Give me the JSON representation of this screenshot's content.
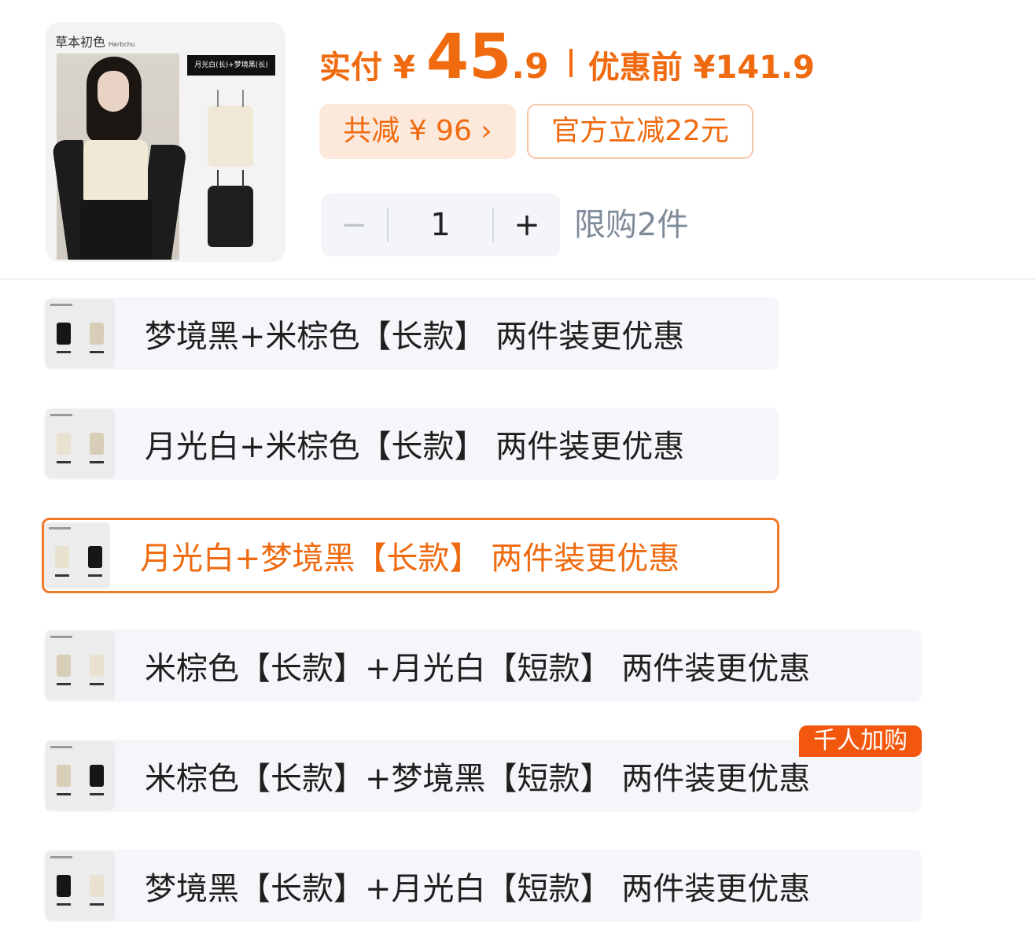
{
  "product": {
    "brand": "草本初色",
    "brand_sub": "Herbchu",
    "image_tag": "月光白(长)+梦境黑(长)"
  },
  "price": {
    "pay_label": "实付",
    "currency": "¥",
    "final_int": "45",
    "final_dec": ".9",
    "original_label": "优惠前 ¥141.9"
  },
  "discounts": {
    "total_save": "共减 ¥ 96 ›",
    "official": "官方立减22元"
  },
  "quantity": {
    "minus": "−",
    "value": "1",
    "plus": "+",
    "limit": "限购2件"
  },
  "options": [
    {
      "label": "梦境黑+米棕色【长款】 两件装更优惠",
      "selected": false
    },
    {
      "label": "月光白+米棕色【长款】 两件装更优惠",
      "selected": false
    },
    {
      "label": "月光白+梦境黑【长款】 两件装更优惠",
      "selected": true
    },
    {
      "label": "米棕色【长款】+月光白【短款】 两件装更优惠",
      "selected": false
    },
    {
      "label": "米棕色【长款】+梦境黑【短款】 两件装更优惠",
      "selected": false,
      "tag": "千人加购"
    },
    {
      "label": "梦境黑【长款】+月光白【短款】 两件装更优惠",
      "selected": false
    }
  ],
  "colors": {
    "accent": "#f06a0f",
    "option_bg": "#f4f6f9",
    "hot_tag": "#f3570e"
  }
}
